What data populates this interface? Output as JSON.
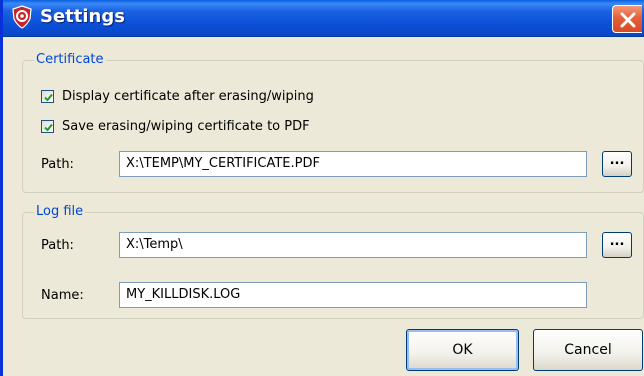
{
  "window": {
    "title": "Settings",
    "icon": "killdisk-shield-icon",
    "close_icon": "close-icon"
  },
  "certificate": {
    "legend": "Certificate",
    "display_after": {
      "label": "Display certificate after erasing/wiping",
      "checked": true
    },
    "save_pdf": {
      "label": "Save erasing/wiping certificate to PDF",
      "checked": true
    },
    "path_label": "Path:",
    "path_value": "X:\\TEMP\\MY_CERTIFICATE.PDF",
    "browse_label": "..."
  },
  "log_file": {
    "legend": "Log file",
    "path_label": "Path:",
    "path_value": "X:\\Temp\\",
    "browse_label": "...",
    "name_label": "Name:",
    "name_value": "MY_KILLDISK.LOG"
  },
  "buttons": {
    "ok": "OK",
    "cancel": "Cancel"
  },
  "colors": {
    "titlebar": "#0b4fd6",
    "group_legend": "#0046d5",
    "close_button": "#d84a23"
  }
}
